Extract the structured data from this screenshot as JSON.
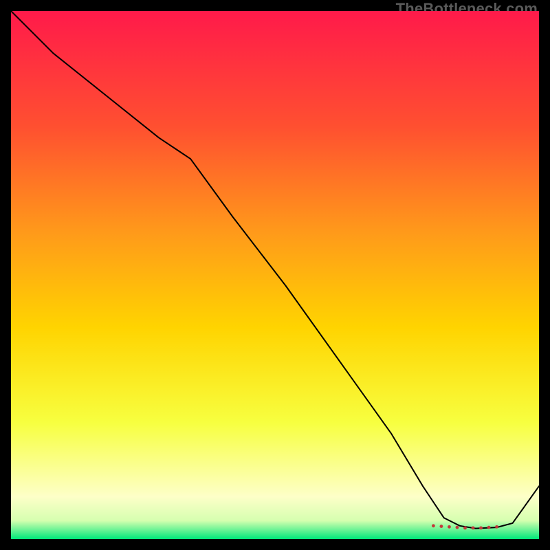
{
  "watermark": "TheBottleneck.com",
  "chart_data": {
    "type": "line",
    "title": "",
    "xlabel": "",
    "ylabel": "",
    "xlim": [
      0,
      100
    ],
    "ylim": [
      0,
      100
    ],
    "grid": false,
    "legend": false,
    "background_gradient": {
      "stops": [
        {
          "offset": 0.0,
          "color": "#ff1a4a"
        },
        {
          "offset": 0.22,
          "color": "#ff5030"
        },
        {
          "offset": 0.42,
          "color": "#ff9a1a"
        },
        {
          "offset": 0.6,
          "color": "#ffd400"
        },
        {
          "offset": 0.78,
          "color": "#f7ff40"
        },
        {
          "offset": 0.92,
          "color": "#fdffc8"
        },
        {
          "offset": 0.965,
          "color": "#d6ffb0"
        },
        {
          "offset": 1.0,
          "color": "#00e77a"
        }
      ]
    },
    "series": [
      {
        "name": "curve",
        "color": "#000000",
        "width": 2,
        "x": [
          0,
          8,
          18,
          28,
          34,
          42,
          52,
          62,
          72,
          78,
          82,
          85,
          88,
          92,
          95,
          100
        ],
        "y": [
          100,
          92,
          84,
          76,
          72,
          61,
          48,
          34,
          20,
          10,
          4,
          2.5,
          2,
          2.2,
          3,
          10
        ]
      }
    ],
    "markers": {
      "comment": "flat-bottom dotted segment",
      "color": "#c23a3a",
      "radius": 2.4,
      "x": [
        80,
        81.5,
        83,
        84.5,
        86,
        87.5,
        89,
        90.5,
        92
      ],
      "y": [
        2.5,
        2.4,
        2.3,
        2.2,
        2.1,
        2.1,
        2.1,
        2.2,
        2.3
      ]
    }
  }
}
